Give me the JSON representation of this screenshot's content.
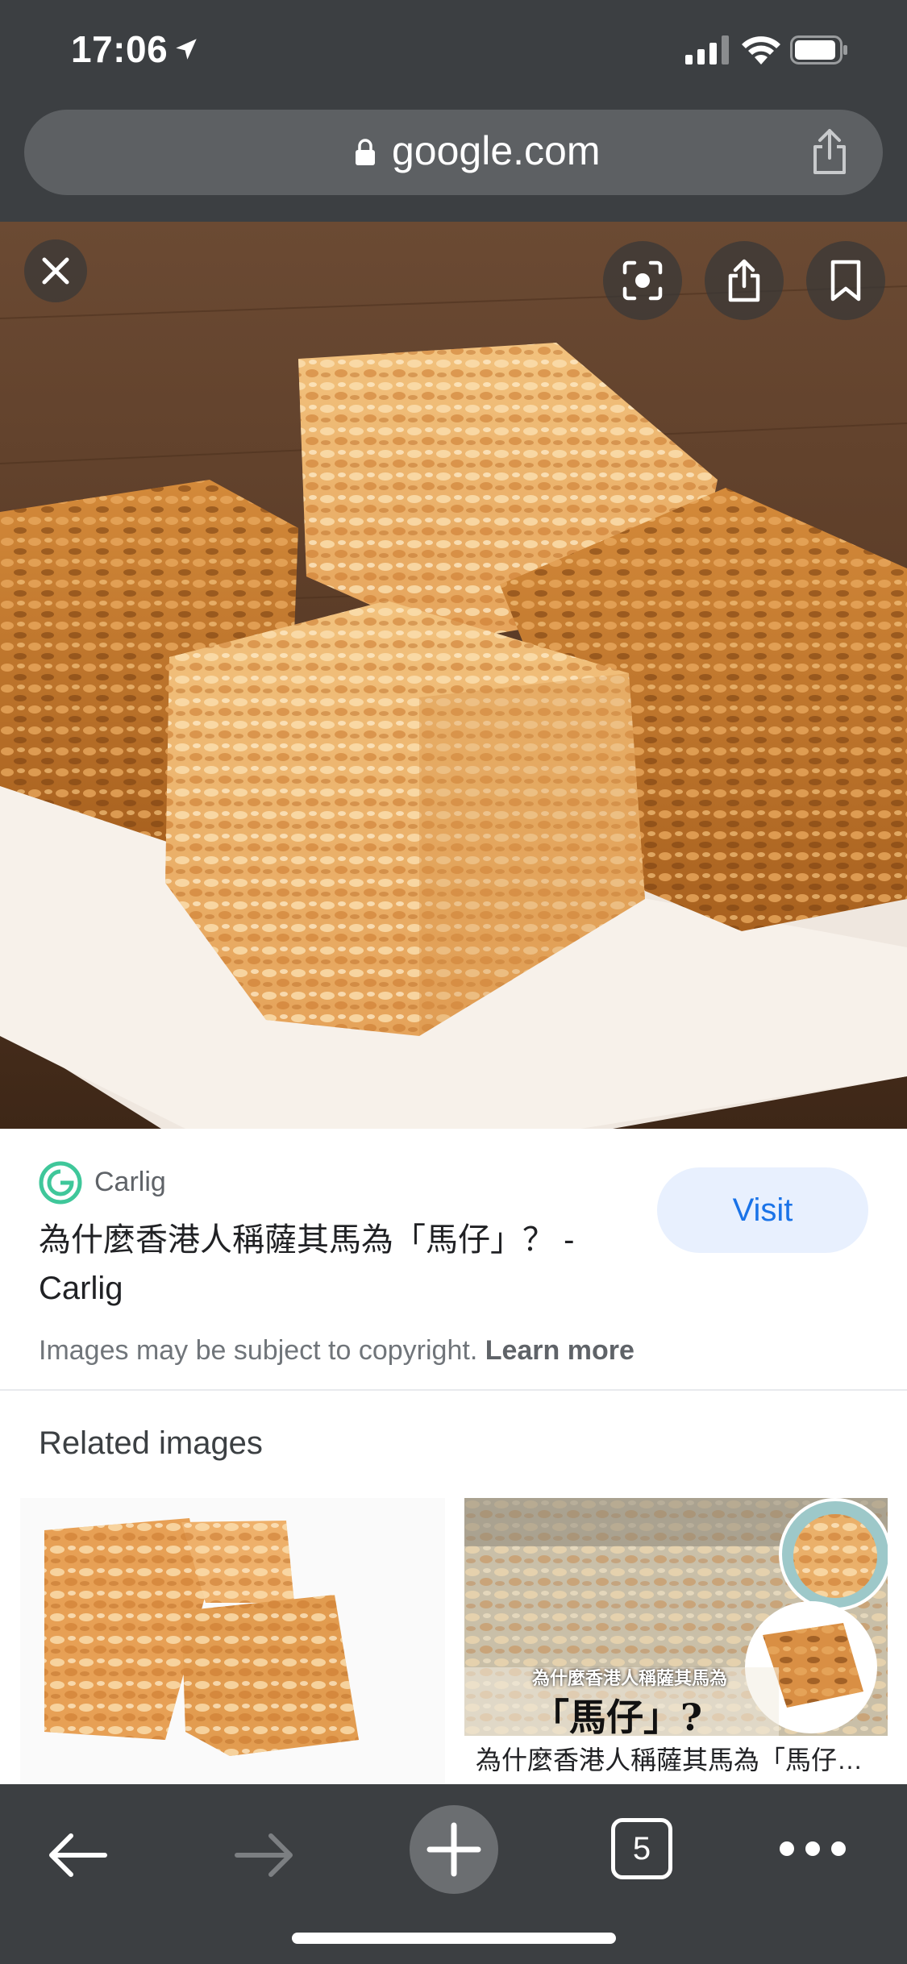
{
  "status_bar": {
    "time": "17:06",
    "icons": [
      "location-arrow-icon",
      "cellular-signal-icon",
      "wifi-icon",
      "battery-icon"
    ]
  },
  "url_bar": {
    "domain": "google.com",
    "icons": [
      "lock-icon",
      "share-icon"
    ]
  },
  "image_viewer": {
    "image_subject": "peanut rice crispy treat squares (馬仔) on a white plate",
    "buttons": [
      "close-icon",
      "lens-icon",
      "share-icon",
      "bookmark-icon"
    ]
  },
  "result": {
    "source_name": "Carlig",
    "title": "為什麼香港人稱薩其馬為「馬仔」？ - Carlig",
    "visit_label": "Visit",
    "copyright_text": "Images may be subject to copyright.",
    "learn_more": "Learn more"
  },
  "related": {
    "heading": "Related images",
    "items": [
      {
        "caption": ""
      },
      {
        "caption": "為什麼香港人稱薩其馬為「馬仔」…",
        "overlay_line1": "為什麼香港人稱薩其馬為",
        "overlay_line2": "「馬仔」?"
      }
    ]
  },
  "toolbar": {
    "tab_count": "5",
    "icons": [
      "back-arrow-icon",
      "forward-arrow-icon",
      "new-tab-plus-icon",
      "tabs-icon",
      "more-icon"
    ]
  },
  "colors": {
    "chrome_bg": "#3c3f42",
    "url_pill": "#5d6063",
    "visit_bg": "#e8f0fe",
    "visit_text": "#1a73e8",
    "carlig_green": "#3fc79a"
  }
}
